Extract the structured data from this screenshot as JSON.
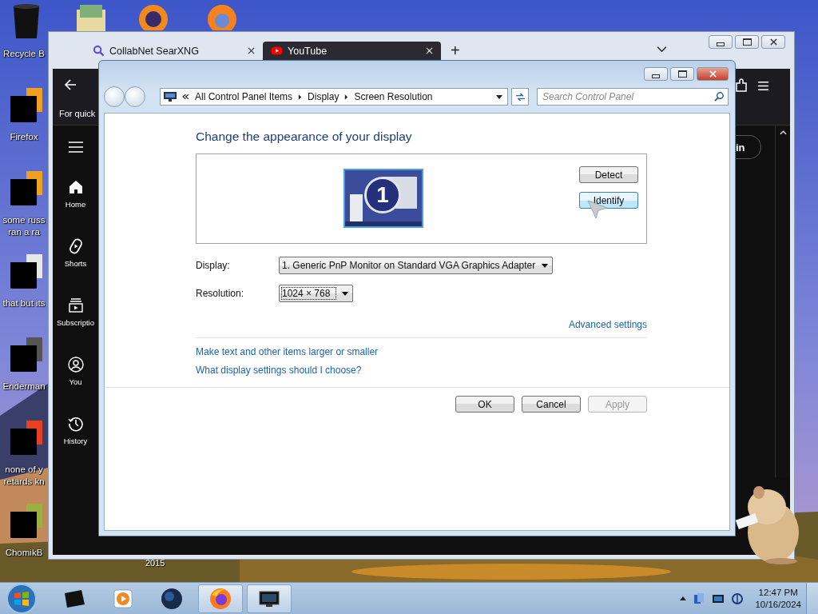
{
  "desktop": {
    "icons": [
      {
        "label": "Recycle B"
      },
      {
        "label": "Firefox"
      },
      {
        "label": "some russ\nran a ra"
      },
      {
        "label": "that but its"
      },
      {
        "label": "Enderman"
      },
      {
        "label": "none of y\nretards kn"
      },
      {
        "label": "ChomikB"
      }
    ],
    "caption": "2015"
  },
  "browser": {
    "tabs": [
      {
        "label": "CollabNet SearXNG",
        "selected": false
      },
      {
        "label": "YouTube",
        "selected": true
      }
    ],
    "new_tab": "+",
    "notice": "For quick",
    "sidebar": [
      {
        "label": "Home"
      },
      {
        "label": "Shorts"
      },
      {
        "label": "Subscriptio"
      },
      {
        "label": "You"
      },
      {
        "label": "History"
      }
    ],
    "sign_in": "in"
  },
  "control_panel": {
    "breadcrumb": [
      "All Control Panel Items",
      "Display",
      "Screen Resolution"
    ],
    "search": {
      "placeholder": "Search Control Panel"
    },
    "heading": "Change the appearance of your display",
    "monitor_number": "1",
    "panel_buttons": [
      "Detect",
      "Identify"
    ],
    "display": {
      "label": "Display:",
      "value": "1. Generic PnP Monitor on Standard VGA Graphics Adapter"
    },
    "resolution": {
      "label": "Resolution:",
      "value": "1024 × 768"
    },
    "advanced_link": "Advanced settings",
    "links": [
      "Make text and other items larger or smaller",
      "What display settings should I choose?"
    ],
    "buttons": [
      {
        "label": "OK",
        "disabled": false
      },
      {
        "label": "Cancel",
        "disabled": false
      },
      {
        "label": "Apply",
        "disabled": true
      }
    ]
  },
  "taskbar": {
    "items": [
      {
        "running": false
      },
      {
        "running": false
      },
      {
        "running": false
      },
      {
        "running": true
      },
      {
        "running": true
      }
    ],
    "time": "12:47 PM",
    "date": "10/16/2024"
  }
}
